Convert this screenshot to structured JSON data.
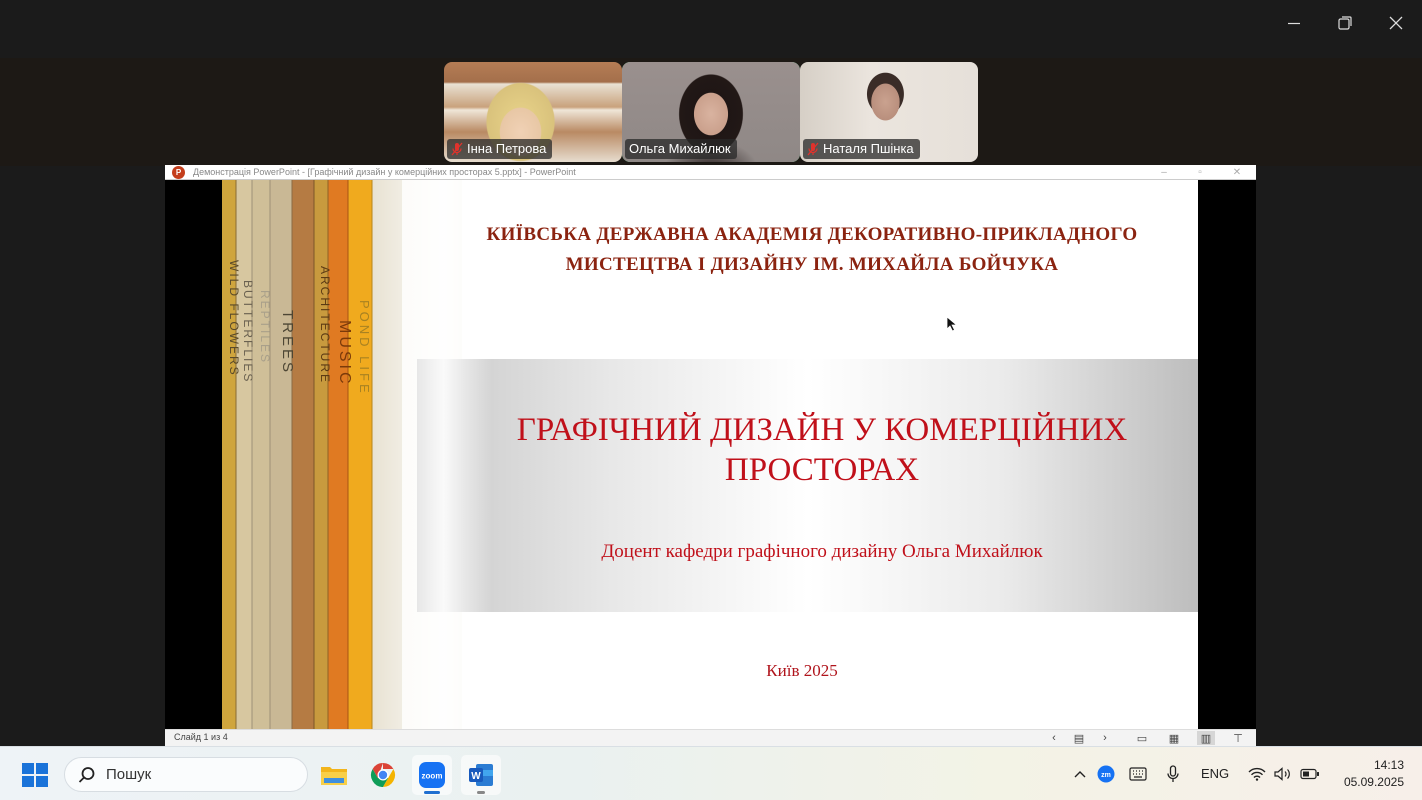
{
  "window": {
    "controls": [
      "minimize-icon",
      "restore-icon",
      "close-icon"
    ]
  },
  "participants": [
    {
      "name": "Інна Петрова",
      "muted": true,
      "active": false
    },
    {
      "name": "Ольга Михайлюк",
      "muted": false,
      "active": true
    },
    {
      "name": "Наталя Пшінка",
      "muted": true,
      "active": false
    }
  ],
  "powerpoint": {
    "window_title": "Демонстрація PowerPoint - [Графічний дизайн у комерційних просторах 5.pptx] - PowerPoint",
    "status_slide": "Слайд 1 из 4",
    "slide": {
      "academy": "КИЇВСЬКА ДЕРЖАВНА АКАДЕМІЯ ДЕКОРАТИВНО-ПРИКЛАДНОГО МИСТЕЦТВА І ДИЗАЙНУ ІМ. МИХАЙЛА БОЙЧУКА",
      "title": "ГРАФІЧНИЙ ДИЗАЙН У КОМЕРЦІЙНИХ ПРОСТОРАХ",
      "author": "Доцент кафедри графічного дизайну Ольга Михайлюк",
      "city_year": "Київ 2025",
      "book_spines": [
        "WILD FLOWERS",
        "BUTTERFLIES",
        "REPTILES",
        "TREES",
        "ARCHITECTURE",
        "MUSIC",
        "POND LIFE"
      ]
    }
  },
  "taskbar": {
    "search_placeholder": "Пошук",
    "apps": [
      "file-explorer",
      "chrome",
      "zoom",
      "word"
    ],
    "language": "ENG",
    "time": "14:13",
    "date": "05.09.2025"
  }
}
